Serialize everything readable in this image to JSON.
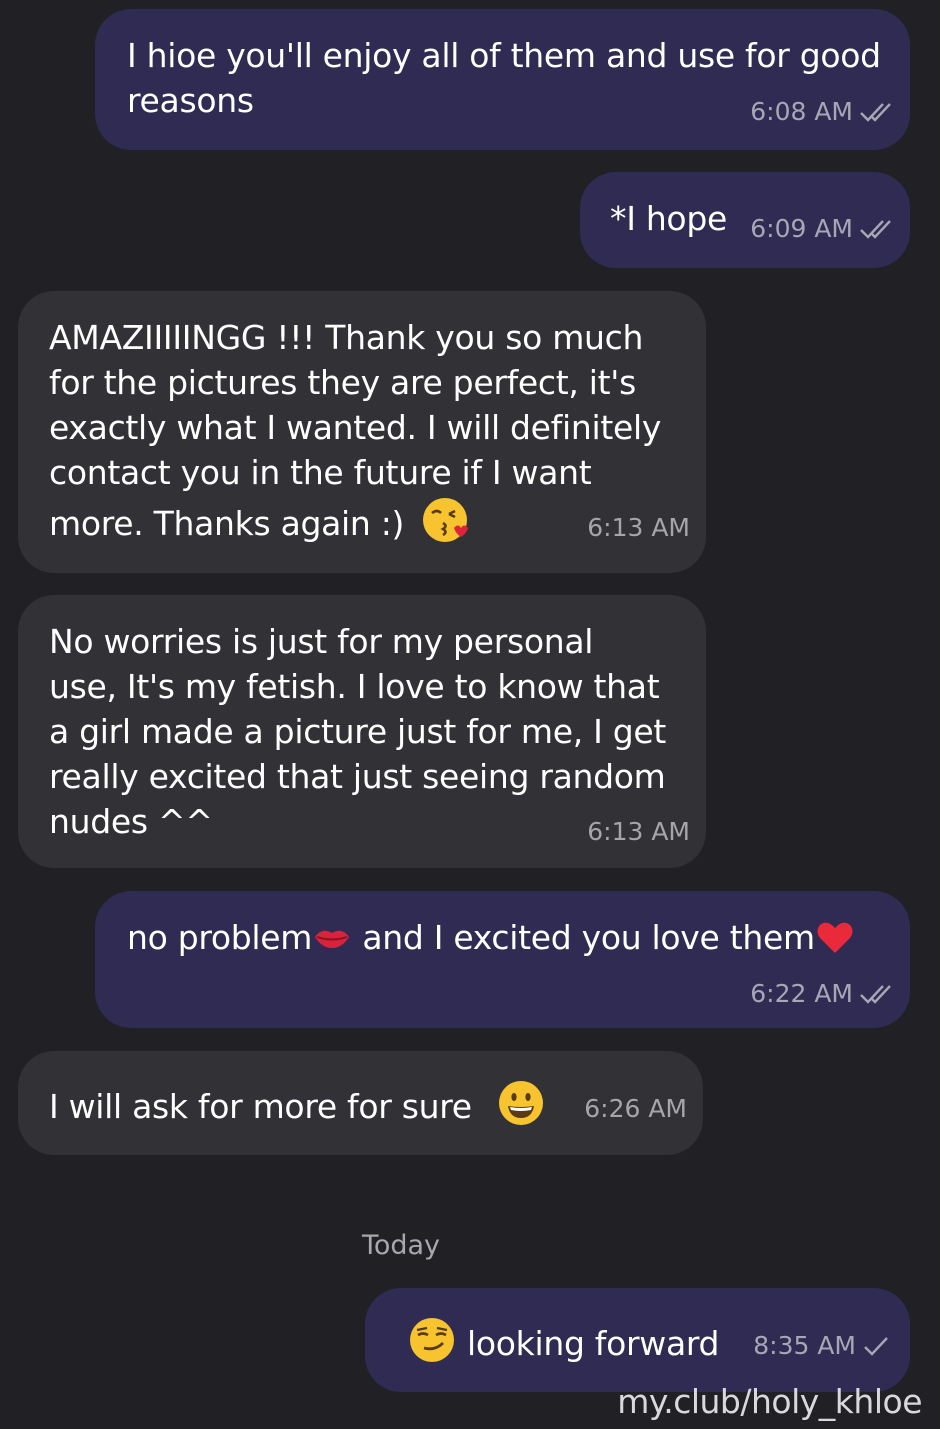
{
  "messages": [
    {
      "direction": "out",
      "lines": [
        "I hioe you'll enjoy all of them and use for good",
        "reasons"
      ],
      "time": "6:08 AM",
      "status": "read"
    },
    {
      "direction": "out",
      "lines": [
        "*I hope"
      ],
      "time": "6:09 AM",
      "status": "read"
    },
    {
      "direction": "in",
      "lines": [
        "AMAZIIIIINGG !!! Thank you so much",
        "for the pictures they are perfect, it's",
        "exactly what I wanted. I will definitely",
        "contact you in the future if I want",
        "more. Thanks again :)"
      ],
      "emoji": "kissing-face-icon",
      "time": "6:13 AM"
    },
    {
      "direction": "in",
      "lines": [
        "No worries is just for my personal",
        "use, It's my fetish. I love to know that",
        "a girl made a picture just for me, I get",
        "really excited that just seeing random",
        "nudes ^^"
      ],
      "time": "6:13 AM"
    },
    {
      "direction": "out",
      "parts": [
        "no problem",
        " and I excited you love them"
      ],
      "emojis": [
        "lips-icon",
        "red-heart-icon"
      ],
      "time": "6:22 AM",
      "status": "read"
    },
    {
      "direction": "in",
      "lines": [
        "I will ask for more for sure"
      ],
      "emoji": "grinning-face-icon",
      "time": "6:26 AM"
    },
    {
      "direction": "out",
      "lines": [
        "looking forward"
      ],
      "emoji": "smirking-face-icon",
      "time": "8:35 AM",
      "status": "sent"
    }
  ],
  "date_separator": "Today",
  "watermark": "my.club/holy_khloe",
  "colors": {
    "background": "#212024",
    "outgoing_bubble": "#2f2b52",
    "incoming_bubble": "#323135",
    "timestamp": "#a8a6b4"
  }
}
